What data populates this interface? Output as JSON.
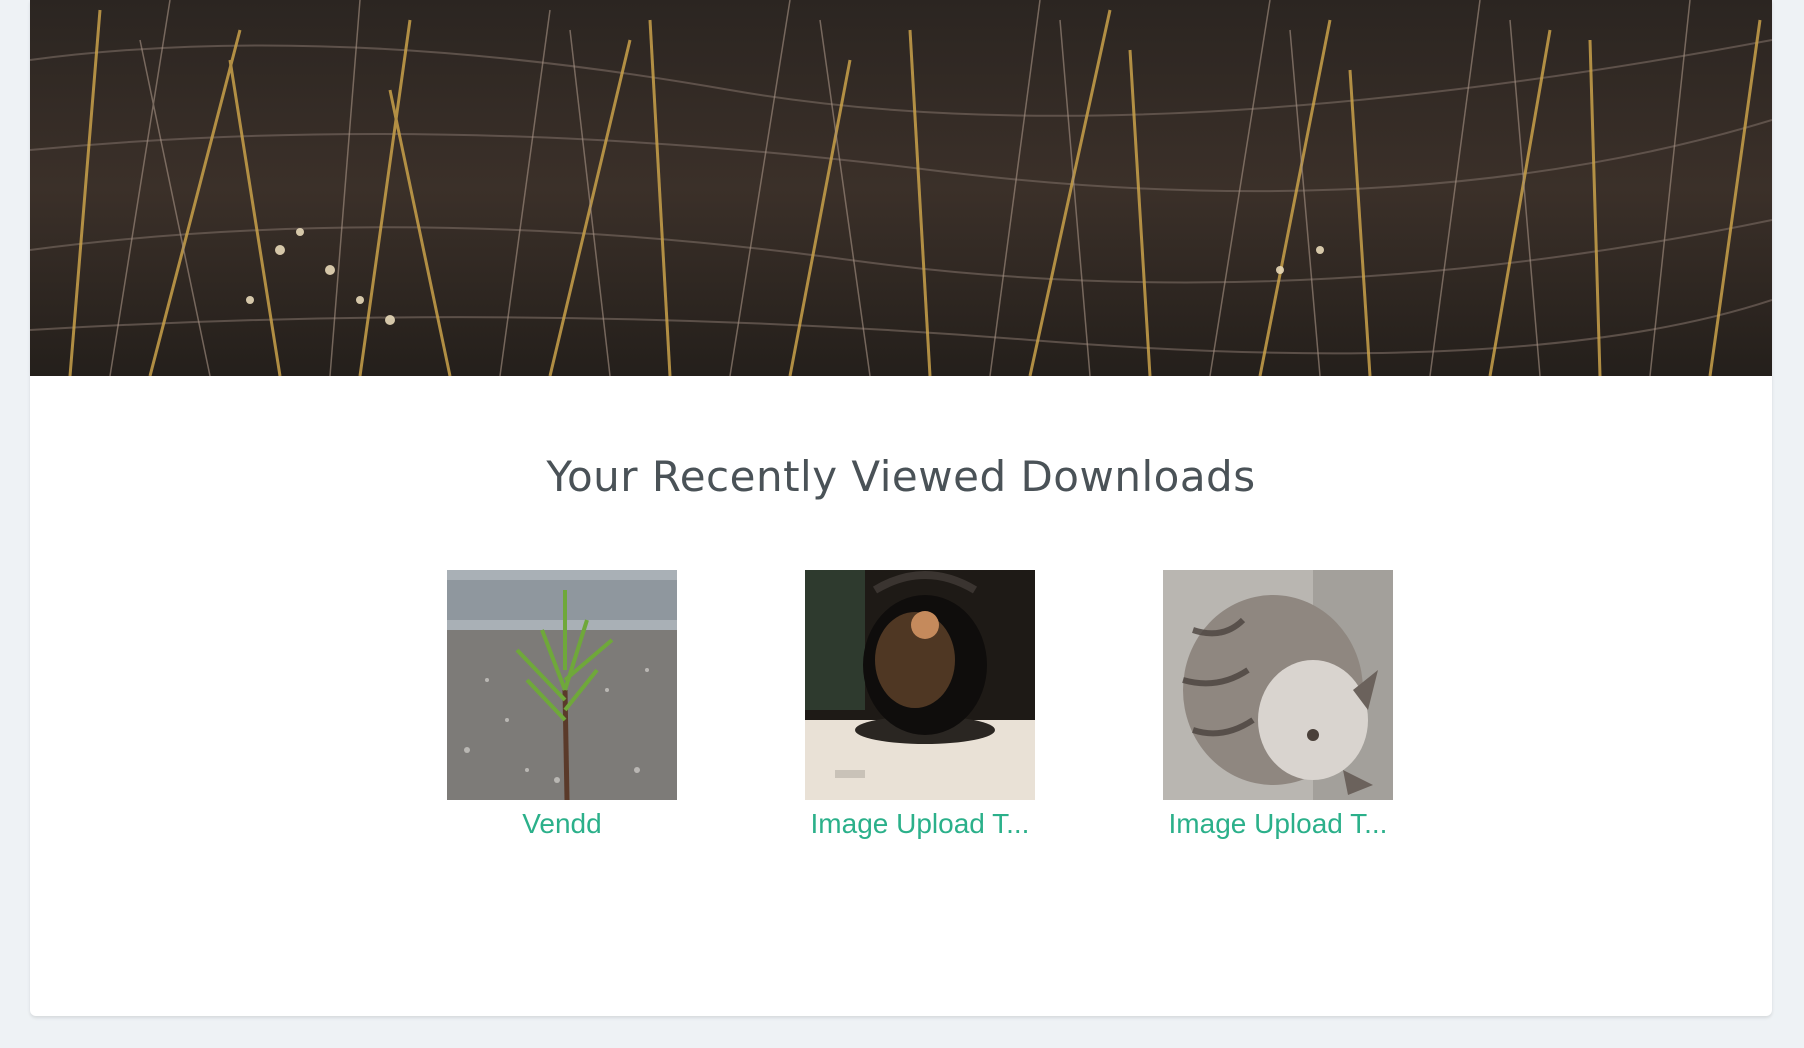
{
  "section": {
    "title": "Your Recently Viewed Downloads"
  },
  "downloads": [
    {
      "title": "Vendd",
      "thumb_icon": "sapling-in-asphalt-image"
    },
    {
      "title": "Image Upload T...",
      "thumb_icon": "kettle-reflection-image"
    },
    {
      "title": "Image Upload T...",
      "thumb_icon": "sleeping-cat-image"
    }
  ],
  "colors": {
    "link": "#2bb08a",
    "heading": "#4a5257",
    "page_bg": "#eef2f5",
    "card_bg": "#ffffff"
  }
}
